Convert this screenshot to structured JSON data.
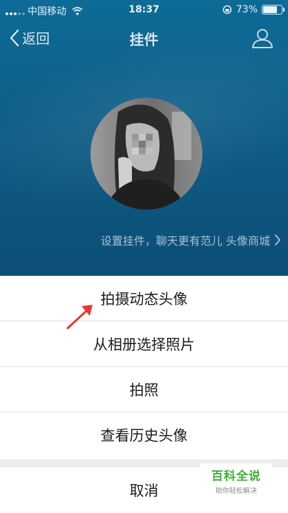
{
  "status_bar": {
    "carrier": "中国移动",
    "time": "18:37",
    "battery_percent": "73%",
    "battery_level": 0.73
  },
  "nav": {
    "back_label": "返回",
    "title": "挂件"
  },
  "pendant_link": "设置挂件，聊天更有范儿 头像商城",
  "action_sheet": {
    "options": [
      "拍摄动态头像",
      "从相册选择照片",
      "拍照",
      "查看历史头像"
    ],
    "cancel": "取消"
  },
  "watermark": {
    "brand": "百科全说",
    "slogan": "助你轻松解决"
  },
  "colors": {
    "header_blue": "#0f5e88",
    "annotation_arrow": "#e8352f",
    "watermark_green": "#3cb034"
  }
}
